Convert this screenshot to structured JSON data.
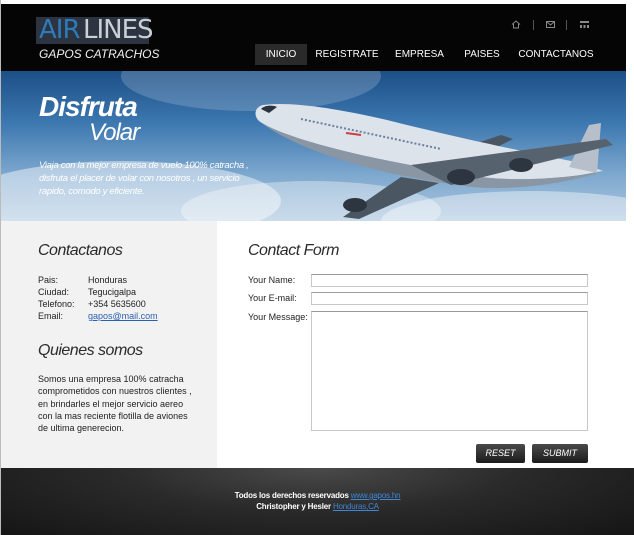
{
  "logo": {
    "air": "AIR",
    "lines": "LINES",
    "subtitle": "GAPOS CATRACHOS"
  },
  "header_icons": [
    "home-icon",
    "mail-icon",
    "sitemap-icon"
  ],
  "nav": [
    {
      "label": "INICIO",
      "active": true
    },
    {
      "label": "REGISTRATE",
      "active": false
    },
    {
      "label": "EMPRESA",
      "active": false
    },
    {
      "label": "PAISES",
      "active": false
    },
    {
      "label": "CONTACTANOS",
      "active": false
    }
  ],
  "banner": {
    "title1": "Disfruta",
    "title2": "Volar",
    "text": "Viaja con la mejor empresa de vuelo 100% catracha , disfruta el placer de volar con nosotros , un servicio rapido, comodo y eficiente."
  },
  "contact": {
    "title": "Contactanos",
    "rows": [
      {
        "label": "Pais:",
        "value": "Honduras"
      },
      {
        "label": "Ciudad:",
        "value": "Tegucigalpa"
      },
      {
        "label": "Telefono:",
        "value": "+354 5635600"
      },
      {
        "label": "Email:",
        "value": "gapos@mail.com"
      }
    ]
  },
  "about": {
    "title": "Quienes somos",
    "text": "Somos una empresa 100% catracha comprometidos con nuestros clientes , en brindarles el mejor servicio aereo con la mas reciente flotilla de aviones de ultima generecion."
  },
  "form": {
    "title": "Contact Form",
    "name_label": "Your Name:",
    "email_label": "Your E-mail:",
    "message_label": "Your Message:",
    "name_value": "",
    "email_value": "",
    "message_value": "",
    "reset_label": "RESET",
    "submit_label": "SUBMIT"
  },
  "footer": {
    "rights": "Todos los derechos reservados",
    "site_link": "www.gapos.hn",
    "authors": "Christopher y Hesler",
    "place_link": "Honduras,CA"
  },
  "colors": {
    "header_bg": "#050505",
    "logo_blue": "#2f7ab8",
    "link": "#2a5fb0",
    "panel_bg": "#f2f2f2"
  }
}
